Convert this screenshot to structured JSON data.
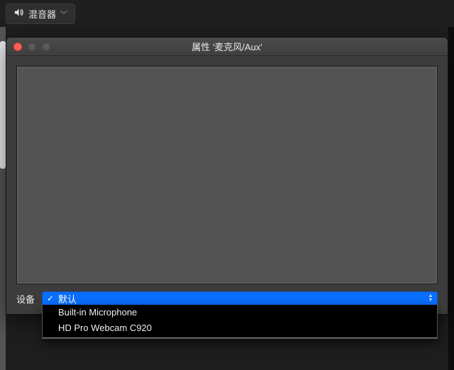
{
  "topbar": {
    "mixer_label": "混音器"
  },
  "dialog": {
    "title": "属性 '麦克风/Aux'"
  },
  "device": {
    "label": "设备",
    "selected": "默认",
    "options": [
      {
        "label": "默认",
        "selected": true
      },
      {
        "label": "Built-in Microphone",
        "selected": false
      },
      {
        "label": "HD Pro Webcam C920",
        "selected": false
      }
    ]
  },
  "icons": {
    "speaker": "speaker-icon",
    "chevron_down": "chevron-down-icon",
    "close": "close-icon",
    "minimize": "minimize-icon",
    "zoom": "zoom-icon",
    "checkmark": "checkmark-icon",
    "stepper": "stepper-icon"
  },
  "colors": {
    "selection": "#0a6fff",
    "panel": "#3c3c3c",
    "preview": "#535353"
  }
}
